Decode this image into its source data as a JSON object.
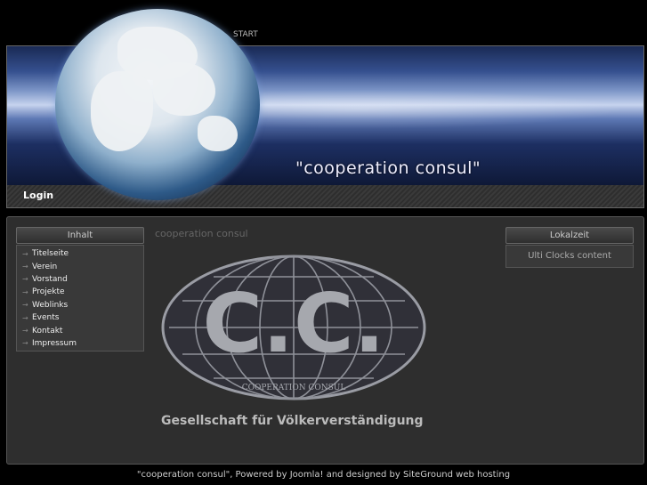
{
  "topnav": {
    "start_label": "START"
  },
  "header": {
    "tagline": "\"cooperation consul\""
  },
  "loginbar": {
    "login_label": "Login"
  },
  "left_module": {
    "title": "Inhalt",
    "items": [
      {
        "label": "Titelseite"
      },
      {
        "label": "Verein"
      },
      {
        "label": "Vorstand"
      },
      {
        "label": "Projekte"
      },
      {
        "label": "Weblinks"
      },
      {
        "label": "Events"
      },
      {
        "label": "Kontakt"
      },
      {
        "label": "Impressum"
      }
    ]
  },
  "content": {
    "title": "cooperation consul",
    "logo_letters": "C.C.",
    "logo_ring_text": "COOPERATION CONSUL",
    "subtitle": "Gesellschaft für Völkerverständigung"
  },
  "right_module": {
    "title": "Lokalzeit",
    "body": "Ulti Clocks content"
  },
  "footer": {
    "text": "\"cooperation consul\", Powered by Joomla! and designed by SiteGround web hosting"
  },
  "icons": {
    "menu_arrow": "→"
  }
}
